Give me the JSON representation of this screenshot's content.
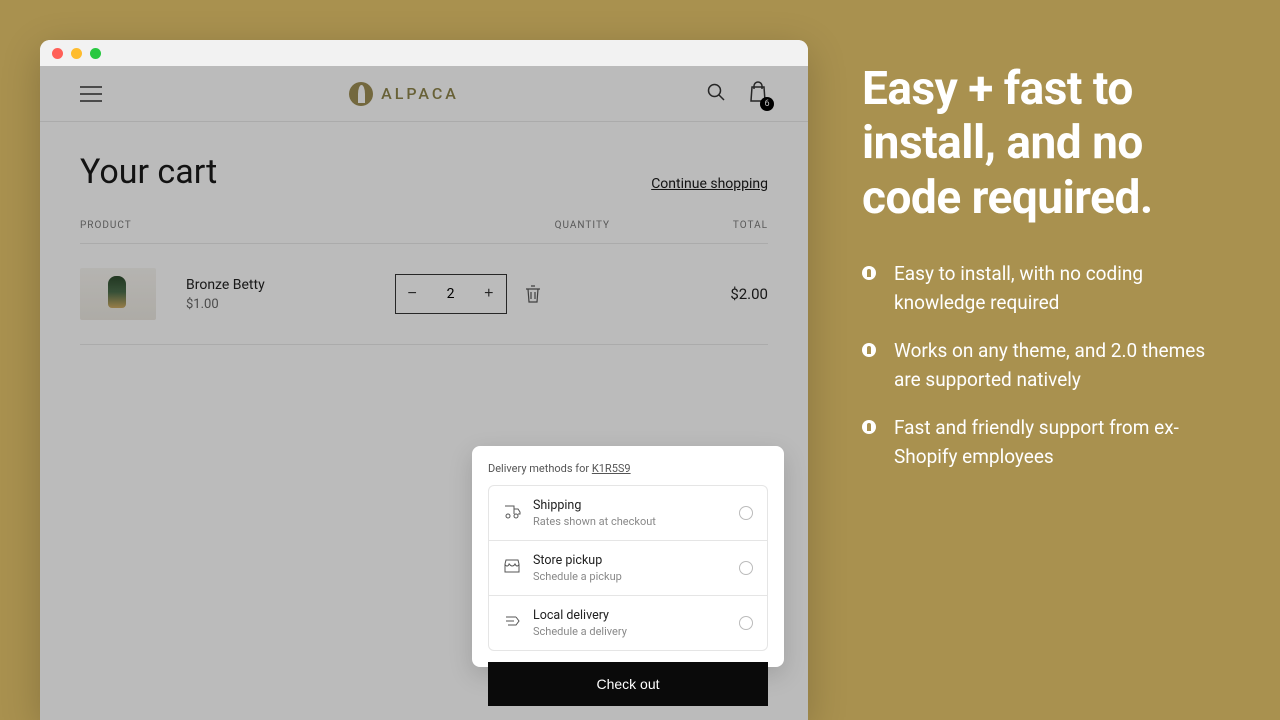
{
  "brand": {
    "name": "ALPACA"
  },
  "header": {
    "cart_count": "6"
  },
  "cart": {
    "title": "Your cart",
    "continue_label": "Continue shopping",
    "columns": {
      "product": "PRODUCT",
      "quantity": "QUANTITY",
      "total": "TOTAL"
    },
    "item": {
      "name": "Bronze Betty",
      "price": "$1.00",
      "quantity": "2",
      "total": "$2.00"
    }
  },
  "delivery": {
    "title_prefix": "Delivery methods for ",
    "postal_code": "K1R5S9",
    "options": [
      {
        "label": "Shipping",
        "sub": "Rates shown at checkout"
      },
      {
        "label": "Store pickup",
        "sub": "Schedule a pickup"
      },
      {
        "label": "Local delivery",
        "sub": "Schedule a delivery"
      }
    ]
  },
  "checkout": {
    "label": "Check out"
  },
  "marketing": {
    "headline": "Easy + fast to install, and no code required.",
    "bullets": [
      "Easy to install, with no coding knowledge required",
      "Works on any theme, and 2.0 themes are supported natively",
      "Fast and friendly support from ex-Shopify employees"
    ]
  }
}
